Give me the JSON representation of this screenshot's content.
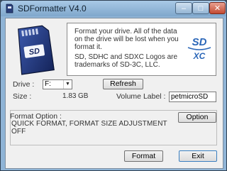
{
  "window": {
    "title": "SDFormatter V4.0",
    "minimize": "–",
    "maximize": "□",
    "close": "✕"
  },
  "info": {
    "line1": "Format your drive. All of the data on the drive will be lost when you format it.",
    "line2": "SD, SDHC and SDXC Logos are trademarks of SD-3C, LLC.",
    "logo_sd": "SD",
    "logo_xc": "XC"
  },
  "drive": {
    "label": "Drive :",
    "value": "F:",
    "refresh": "Refresh"
  },
  "size": {
    "label": "Size :",
    "value": "1.83",
    "unit": "GB"
  },
  "volume": {
    "label": "Volume Label :",
    "value": "petmicroSD"
  },
  "format_option": {
    "title": "Format Option :",
    "button": "Option",
    "text": "QUICK FORMAT, FORMAT SIZE ADJUSTMENT OFF"
  },
  "actions": {
    "format": "Format",
    "exit": "Exit"
  },
  "colors": {
    "title_bar": "#8fb4d6",
    "close_button": "#c34a32",
    "card": "#2a3f7a"
  },
  "icons": {
    "app": "sd-card-icon",
    "sd_card": "sd-card-icon",
    "sdxc_logo": "sdxc-logo-icon"
  }
}
